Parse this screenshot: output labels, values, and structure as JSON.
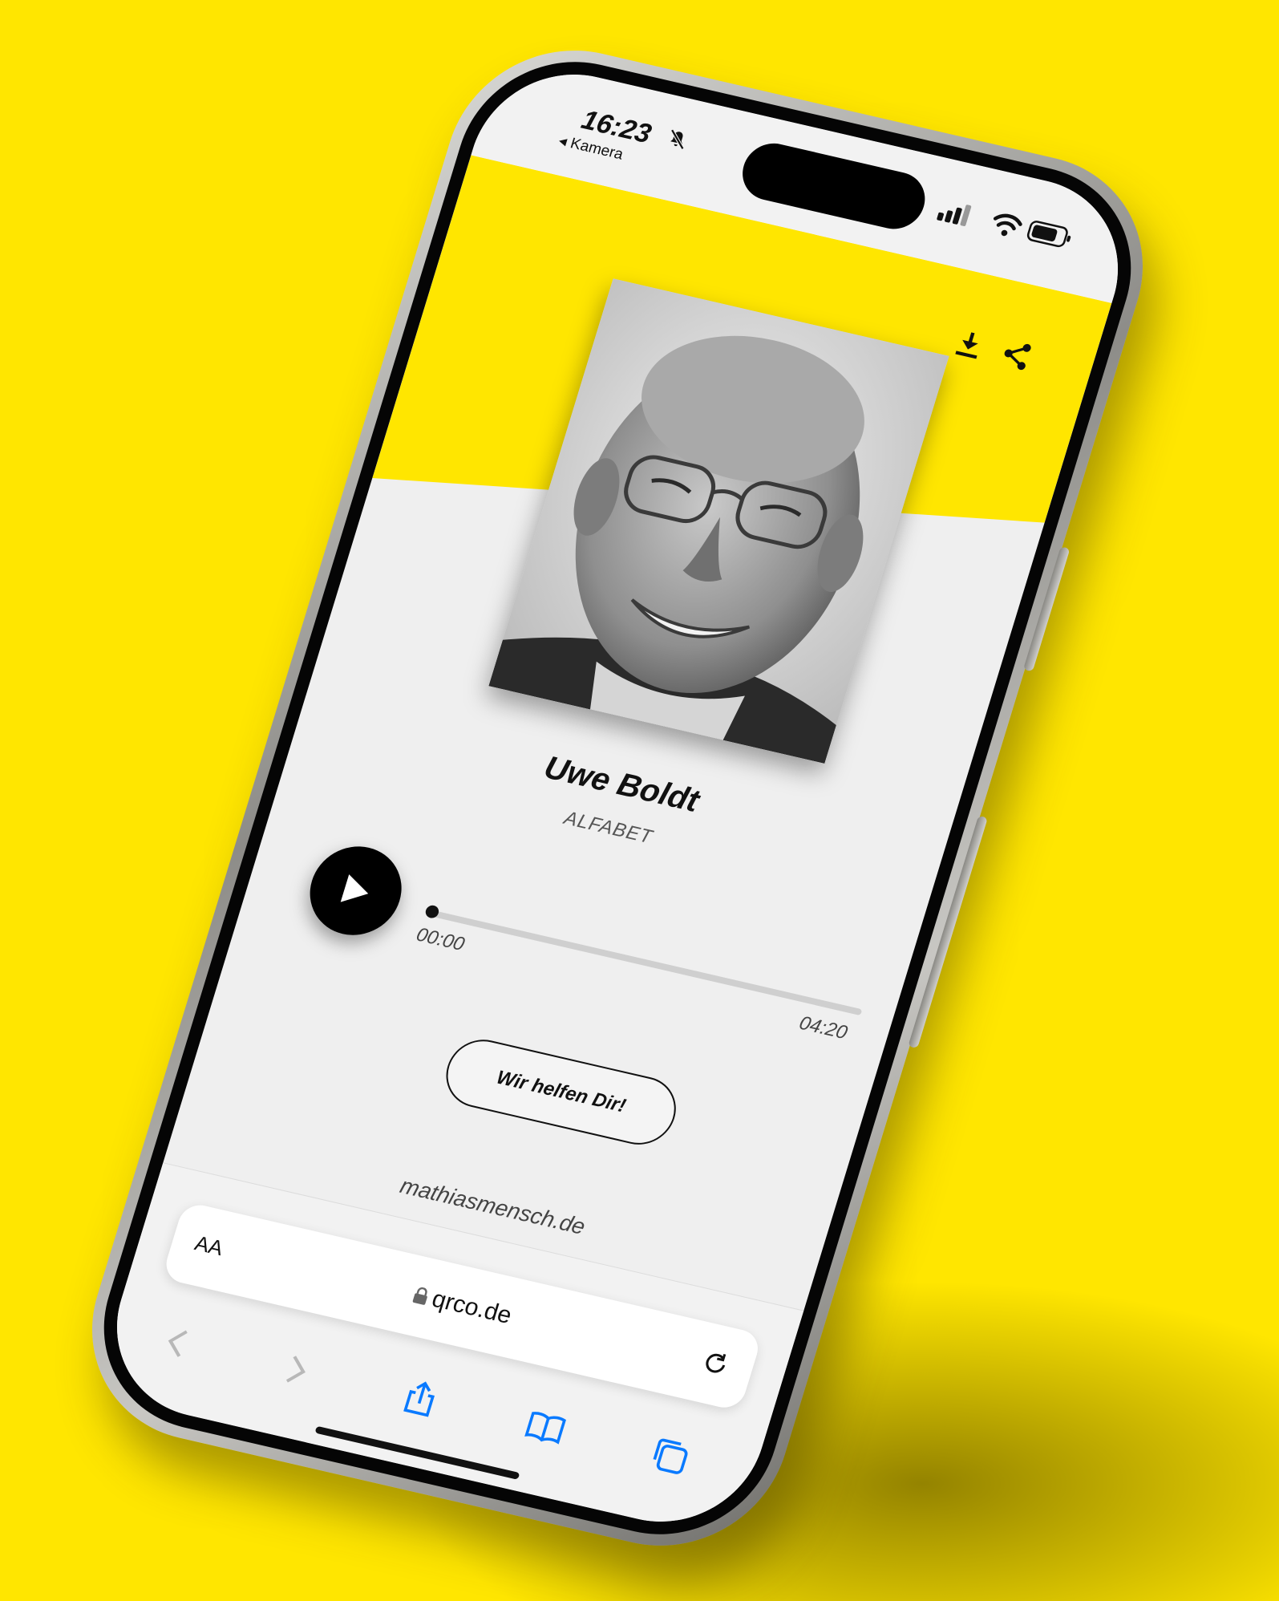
{
  "status_bar": {
    "time": "16:23",
    "back_app": "◂ Kamera"
  },
  "profile": {
    "name": "Uwe Boldt",
    "organization": "ALFABET"
  },
  "player": {
    "current_time": "00:00",
    "duration": "04:20",
    "progress_fraction": 0.0
  },
  "actions": {
    "help_button": "Wir helfen Dir!",
    "website": "mathiasmensch.de"
  },
  "browser": {
    "text_size": "AA",
    "url": "qrco.de"
  },
  "colors": {
    "accent_yellow": "#ffe600",
    "safari_blue": "#0a7aff"
  }
}
